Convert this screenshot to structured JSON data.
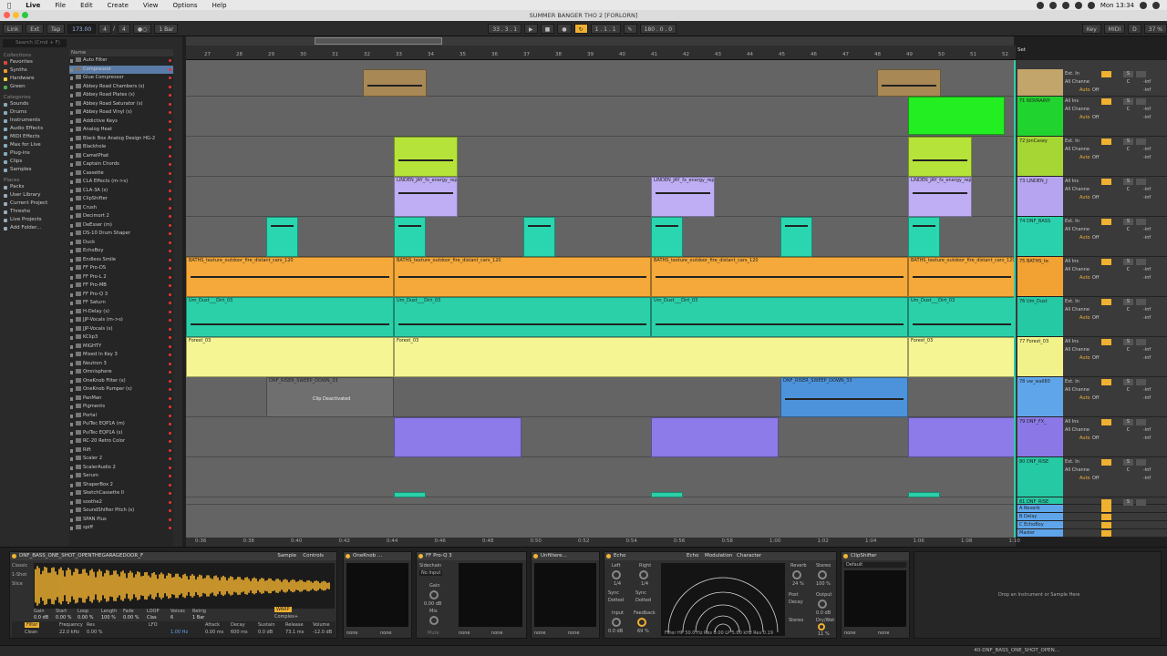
{
  "menubar": {
    "app": "Live",
    "items": [
      "File",
      "Edit",
      "Create",
      "View",
      "Options",
      "Help"
    ],
    "clock": "Mon 13:34"
  },
  "window": {
    "title": "SUMMER BANGER THO 2  [FORLORN]"
  },
  "control": {
    "link": "Link",
    "ext": "Ext",
    "tap": "Tap",
    "tempo": "173.00",
    "sig_num": "4",
    "sig_den": "4",
    "quant": "1 Bar",
    "position": "33 .  3 .  1",
    "loop_start": "1 .  1 .  1",
    "loop_len": "180 .  0 .  0",
    "key": "Key",
    "midi": "MIDI",
    "d": "D",
    "cpu": "37 %"
  },
  "browser": {
    "search_placeholder": "Search (Cmd + F)",
    "collections_title": "Collections",
    "collections": [
      {
        "label": "Favorites",
        "color": "#e0463c"
      },
      {
        "label": "Synths",
        "color": "#f39a2c"
      },
      {
        "label": "Hardware",
        "color": "#f4d33a"
      },
      {
        "label": "Green",
        "color": "#4caf50"
      }
    ],
    "categories_title": "Categories",
    "categories": [
      "Sounds",
      "Drums",
      "Instruments",
      "Audio Effects",
      "MIDI Effects",
      "Max for Live",
      "Plug-ins",
      "Clips",
      "Samples"
    ],
    "places_title": "Places",
    "places": [
      "Packs",
      "User Library",
      "Current Project",
      "Thresho",
      "Live Projects",
      "Add Folder..."
    ],
    "list_header": "Name",
    "plugins": [
      "Auto Filter",
      "Compressor",
      "Glue Compressor",
      "Abbey Road Chambers (s)",
      "Abbey Road Plates (s)",
      "Abbey Road Saturator (s)",
      "Abbey Road Vinyl (s)",
      "Addictive Keys",
      "Analog Heat",
      "Black Box Analog Design HG-2",
      "Blackhole",
      "CamelPhat",
      "Captain Chords",
      "Cassette",
      "CLA Effects (m->s)",
      "CLA-3A (s)",
      "ClipShifter",
      "Crush",
      "Decimort 2",
      "DeEsser (m)",
      "DS-10 Drum Shaper",
      "Duck",
      "EchoBoy",
      "Endless Smile",
      "FF Pro-DS",
      "FF Pro-L 2",
      "FF Pro-MB",
      "FF Pro-Q 3",
      "FF Saturn",
      "H-Delay (s)",
      "JJP-Vocals (m->s)",
      "JJP-Vocals (s)",
      "KClip3",
      "MIGHTY",
      "Mixed In Key 3",
      "Neutron 3",
      "Omnisphere",
      "OneKnob Filter (s)",
      "OneKnob Pumper (s)",
      "PanMan",
      "Pigments",
      "Portal",
      "PulTec EQP1A (m)",
      "PulTec EQP1A (s)",
      "RC-20 Retro Color",
      "Rift",
      "Scaler 2",
      "ScalerAudio 2",
      "Serum",
      "ShaperBox 2",
      "SketchCassette II",
      "soothe2",
      "SoundShifter Pitch (s)",
      "SPAN Plus",
      "spiff"
    ]
  },
  "timeline": {
    "bars": [
      "27",
      "28",
      "29",
      "30",
      "31",
      "32",
      "33",
      "34",
      "35",
      "36",
      "37",
      "38",
      "39",
      "40",
      "41",
      "42",
      "43",
      "44",
      "45",
      "46",
      "47",
      "48",
      "49",
      "50",
      "51",
      "52"
    ],
    "times": [
      "0:36",
      "0:38",
      "0:40",
      "0:42",
      "0:44",
      "0:46",
      "0:48",
      "0:50",
      "0:52",
      "0:54",
      "0:56",
      "0:58",
      "1:00",
      "1:02",
      "1:04",
      "1:06",
      "1:08",
      "1:10"
    ],
    "set_label": "Set"
  },
  "tracks": [
    {
      "name": "",
      "color": "#c2a56a",
      "clip_color": "#a88855"
    },
    {
      "name": "71 NOVRAINY",
      "color": "#21d32e",
      "clip_color": "#22ee22"
    },
    {
      "name": "72 JonCasey",
      "color": "#a6d633",
      "clip_color": "#b6e33a"
    },
    {
      "name": "73 LINDEN_J",
      "color": "#b6a4f0",
      "clip_color": "#bfaef3"
    },
    {
      "name": "74 DNF_BASS",
      "color": "#29d1ac",
      "clip_color": "#2ad6b0"
    },
    {
      "name": "75 BATHS_te",
      "color": "#f2a233",
      "clip_color": "#f5a93a"
    },
    {
      "name": "76 Um_Dust",
      "color": "#25c9a4",
      "clip_color": "#2bd0a9"
    },
    {
      "name": "77 Forest_03",
      "color": "#f2f28a",
      "clip_color": "#f5f594"
    },
    {
      "name": "78 vw_wall80",
      "color": "#5fa5ea",
      "clip_color": "#4c93dc"
    },
    {
      "name": "79 DNF_FX_",
      "color": "#8b78e6",
      "clip_color": "#8c7be8"
    },
    {
      "name": "80 DNF_RISE",
      "color": "#25c9a4",
      "clip_color": "#2bd0a9"
    },
    {
      "name": "81 DNF_RISE",
      "color": "#25c9a4",
      "clip_color": "#2bd0a9"
    }
  ],
  "clip_labels": {
    "linden": "LINDEN_JAY_fx_energy_rep",
    "baths": "BATHS_texture_outdoor_fire_distant_cars_120",
    "um_dust": "Um_Dust___Dirt_03",
    "forest": "Forest_03",
    "riser": "DNF_RISER_SWEEP_DOWN_33",
    "deactivated": "Clip Deactivated"
  },
  "returns": [
    {
      "name": "A Reverb",
      "color": "#5fa5ea"
    },
    {
      "name": "B Delay",
      "color": "#5fa5ea"
    },
    {
      "name": "C EchoBoy",
      "color": "#5fa5ea"
    },
    {
      "name": "Master",
      "color": "#5fa5ea"
    }
  ],
  "mixer": {
    "io_in": "All Ins",
    "io_ext": "Ext. In",
    "all_channels": "All Channe",
    "auto": "Auto",
    "off": "Off",
    "in": "In",
    "neg_inf": "-inf",
    "s": "S",
    "c": "C",
    "fraction": "1/2"
  },
  "devices": {
    "simpler": {
      "title": "DNF_BASS_ONE_SHOT_OPENTHEGARAGEDOOR_F",
      "tab_sample": "Sample",
      "tab_controls": "Controls",
      "labels": [
        "Gain",
        "Start",
        "Loop",
        "Length",
        "Fade",
        "LOOP",
        "Voices",
        "Retrig"
      ],
      "values": [
        "0.0 dB",
        "0.00 %",
        "0.00 %",
        "100 %",
        "0.00 %",
        "Clas",
        "6",
        "1 Bar"
      ],
      "filter": "Filter",
      "freq_label": "Frequency",
      "res_label": "Res",
      "freq": "22.0 kHz",
      "res": "0.00 %",
      "lfo": "LFO",
      "rate": "1.00 Hz",
      "attack_label": "Attack",
      "decay_label": "Decay",
      "sustain_label": "Sustain",
      "release_label": "Release",
      "volume_label": "Volume",
      "attack": "0.00 ms",
      "decay": "600 ms",
      "sustain": "0.0 dB",
      "release": "73.1 ms",
      "volume": "-12.0 dB",
      "warp": "WARP",
      "complex": "Complex+",
      "classic": "Classic",
      "one_shot": "1-Shot",
      "slice": "Slice",
      "mode": "Clean"
    },
    "oneknob": {
      "title": "OneKnob ..."
    },
    "proq": {
      "title": "FF Pro-Q 3",
      "sidechain": "Sidechain",
      "no_input": "No Input",
      "gain": "Gain",
      "gain_val": "0.00 dB",
      "mix": "Mix",
      "mix_val": "0.00 dB",
      "mute": "Mute"
    },
    "unfiltered": {
      "title": "Unfiltere..."
    },
    "echo": {
      "title": "Echo",
      "tabs": [
        "Echo",
        "Modulation",
        "Character"
      ],
      "left": "Left",
      "right": "Right",
      "left_val": "1/4",
      "right_val": "1/4",
      "sync": "Sync",
      "dotted": "Dotted",
      "input": "Input",
      "input_val": "0.0 dB",
      "feedback": "Feedback",
      "feedback_val": "69 %",
      "reverb": "Reverb",
      "reverb_val": "24 %",
      "stereo": "Stereo",
      "stereo_val": "100 %",
      "output": "Output",
      "output_val": "0.0 dB",
      "dry_wet": "Dry/Wet",
      "dry_wet_val": "11 %",
      "post": "Post",
      "decay": "Decay",
      "stereo_mode": "Stereo",
      "filter_line": "Filter HP 50.0 Hz  Res 0.00  LP 5.00 kHz  Res 0.19"
    },
    "clipshifter": {
      "title": "ClipShifter",
      "preset": "Default"
    },
    "drop_hint": "Drop an Instrument or Sample Here",
    "none": "none"
  },
  "status": {
    "right": "40-DNF_BASS_ONE_SHOT_OPEN..."
  }
}
